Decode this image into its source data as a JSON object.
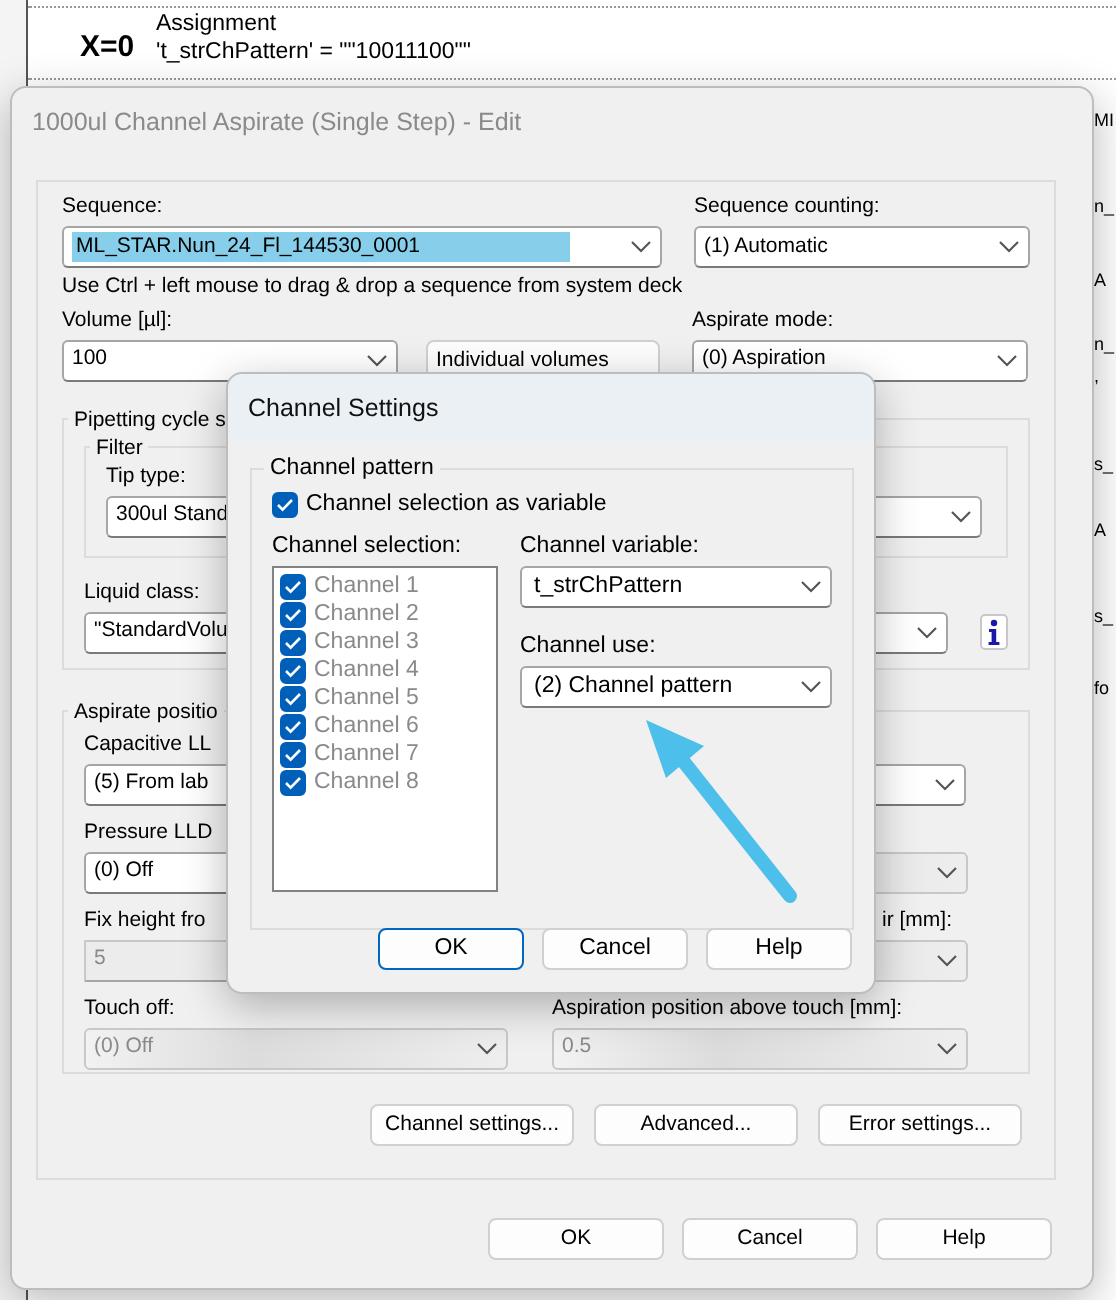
{
  "background": {
    "marker": "X=0",
    "step_title": "Assignment",
    "step_detail": "'t_strChPattern' = \"\"10011100\"\"",
    "edge_fragments": [
      "MI",
      "n_",
      "A",
      "n_",
      ",",
      "s_",
      "A",
      "s_",
      "fo"
    ]
  },
  "main_dialog": {
    "title": "1000ul Channel Aspirate (Single Step) - Edit",
    "active": false,
    "sequence": {
      "label": "Sequence:",
      "value": "ML_STAR.Nun_24_Fl_144530_0001",
      "highlighted": true
    },
    "sequence_counting": {
      "label": "Sequence counting:",
      "value": "(1) Automatic"
    },
    "hint": "Use Ctrl + left mouse to drag & drop a sequence from system deck",
    "volume": {
      "label": "Volume [µl]:",
      "value": "100"
    },
    "individual_volumes_button": "Individual volumes",
    "aspirate_mode": {
      "label": "Aspirate mode:",
      "value": "(0) Aspiration"
    },
    "pipetting_group": {
      "title": "Pipetting cycle s",
      "filter_title": "Filter",
      "tip_type": {
        "label": "Tip type:",
        "value": "300ul Stand"
      },
      "liquid_class": {
        "label": "Liquid class:",
        "value": "\"StandardVolu"
      }
    },
    "aspirate_position": {
      "title": "Aspirate positio",
      "rows": [
        {
          "left": {
            "label": "Capacitive LL",
            "value": "(5) From lab",
            "disabled": false
          }
        },
        {
          "left": {
            "label": "Pressure LLD",
            "value": "(0) Off",
            "disabled": false
          },
          "right": {
            "disabled": true
          }
        },
        {
          "left": {
            "label": "Fix height fro",
            "value": "5",
            "disabled": true,
            "kind": "field"
          },
          "right": {
            "label": "ir [mm]:",
            "disabled": true
          }
        },
        {
          "left": {
            "label": "Touch off:",
            "value": "(0) Off",
            "disabled": true
          },
          "right": {
            "label": "Aspiration position above touch [mm]:",
            "value": "0.5",
            "disabled": true
          }
        }
      ]
    },
    "action_buttons": [
      "Channel settings...",
      "Advanced...",
      "Error settings..."
    ],
    "footer_buttons": [
      {
        "label": "OK",
        "default": false
      },
      {
        "label": "Cancel",
        "default": false
      },
      {
        "label": "Help",
        "default": false
      }
    ]
  },
  "channel_dialog": {
    "title": "Channel Settings",
    "active": true,
    "group_title": "Channel pattern",
    "as_variable": {
      "label": "Channel selection as variable",
      "checked": true
    },
    "selection_label": "Channel selection:",
    "channels": [
      {
        "label": "Channel 1",
        "checked": true,
        "disabled": true
      },
      {
        "label": "Channel 2",
        "checked": true,
        "disabled": true
      },
      {
        "label": "Channel 3",
        "checked": true,
        "disabled": true
      },
      {
        "label": "Channel 4",
        "checked": true,
        "disabled": true
      },
      {
        "label": "Channel 5",
        "checked": true,
        "disabled": true
      },
      {
        "label": "Channel 6",
        "checked": true,
        "disabled": true
      },
      {
        "label": "Channel 7",
        "checked": true,
        "disabled": true
      },
      {
        "label": "Channel 8",
        "checked": true,
        "disabled": true
      }
    ],
    "variable": {
      "label": "Channel variable:",
      "value": "t_strChPattern"
    },
    "use": {
      "label": "Channel use:",
      "value": "(2) Channel pattern"
    },
    "buttons": [
      {
        "label": "OK",
        "default": true
      },
      {
        "label": "Cancel",
        "default": false
      },
      {
        "label": "Help",
        "default": false
      }
    ]
  }
}
